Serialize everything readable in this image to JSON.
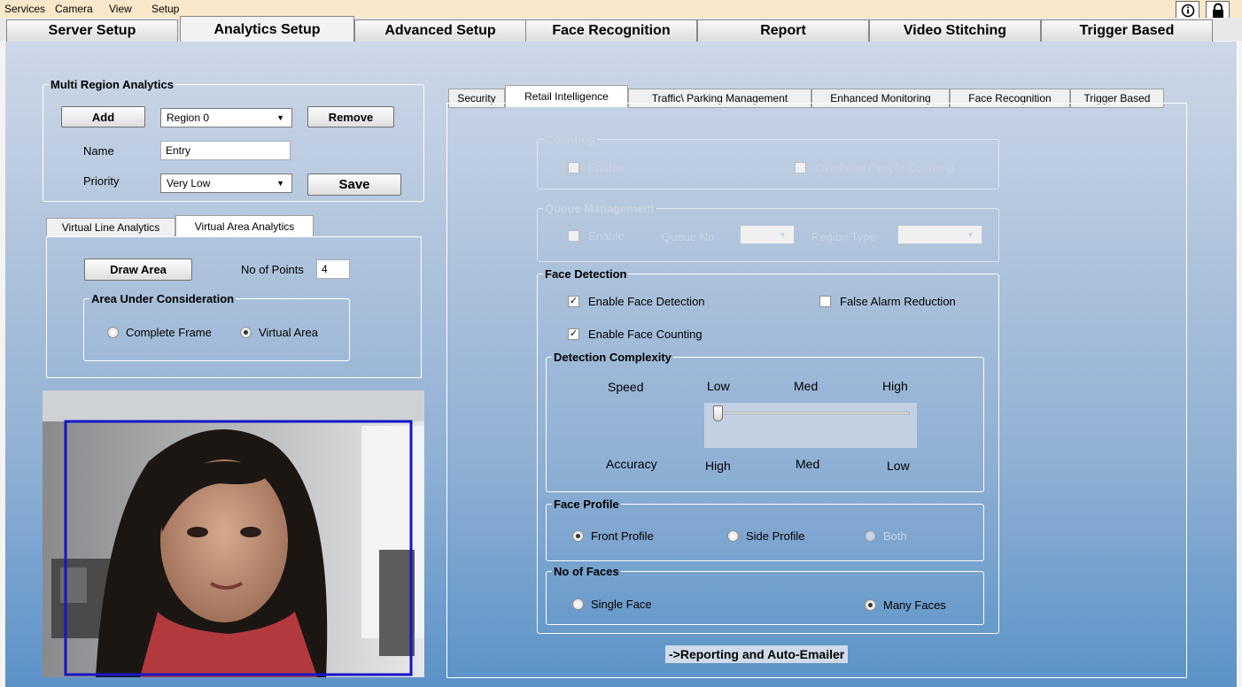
{
  "menubar": {
    "items": [
      "Services",
      "Camera",
      "View",
      "Setup"
    ]
  },
  "main_tabs": [
    "Server Setup",
    "Analytics Setup",
    "Advanced Setup",
    "Face Recognition",
    "Report",
    "Video Stitching",
    "Trigger Based"
  ],
  "multi_region": {
    "title": "Multi Region Analytics",
    "add_label": "Add",
    "region_value": "Region 0",
    "remove_label": "Remove",
    "name_label": "Name",
    "name_value": "Entry",
    "priority_label": "Priority",
    "priority_value": "Very Low",
    "save_label": "Save"
  },
  "left_tabs": [
    "Virtual Line Analytics",
    "Virtual Area Analytics"
  ],
  "virtual_area": {
    "draw_area_label": "Draw Area",
    "points_label": "No of Points",
    "points_value": "4",
    "area_title": "Area Under Consideration",
    "complete_frame": "Complete Frame",
    "virtual_area": "Virtual Area"
  },
  "right_tabs": [
    "Security",
    "Retail Intelligence",
    "Traffic\\ Parking Management",
    "Enhanced Monitoring",
    "Face Recognition",
    "Trigger Based"
  ],
  "counting": {
    "title": "Counting",
    "enable": "Enable",
    "overhead": "Overhead People Counting"
  },
  "queue": {
    "title": "Queue Management",
    "enable": "Enable",
    "queue_no": "Queue No",
    "region_type": "Region Type"
  },
  "face_detection": {
    "title": "Face Detection",
    "enable_detection": "Enable Face Detection",
    "false_alarm": "False Alarm Reduction",
    "enable_counting": "Enable Face Counting",
    "enable_detection_checked": true,
    "enable_counting_checked": true,
    "false_alarm_checked": false
  },
  "complexity": {
    "title": "Detection Complexity",
    "speed_label": "Speed",
    "speed_levels": [
      "Low",
      "Med",
      "High"
    ],
    "accuracy_label": "Accuracy",
    "accuracy_levels": [
      "High",
      "Med",
      "Low"
    ],
    "slider_value": 0
  },
  "face_profile": {
    "title": "Face Profile",
    "front": "Front Profile",
    "side": "Side Profile",
    "both": "Both",
    "selected": "front"
  },
  "num_faces": {
    "title": "No of Faces",
    "single": "Single Face",
    "many": "Many Faces",
    "selected": "many"
  },
  "reporting_label": "->Reporting and Auto-Emailer",
  "colors": {
    "region_box": "#1515c8",
    "menubar_bg": "#f9e8c9"
  }
}
